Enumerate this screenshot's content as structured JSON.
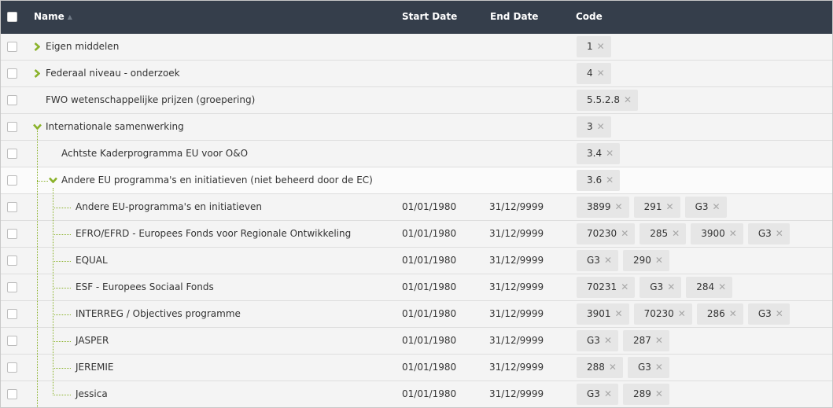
{
  "header": {
    "name": "Name",
    "start_date": "Start Date",
    "end_date": "End Date",
    "code": "Code"
  },
  "rows": [
    {
      "name": "Eigen middelen",
      "start": "",
      "end": "",
      "codes": [
        "1"
      ]
    },
    {
      "name": "Federaal niveau - onderzoek",
      "start": "",
      "end": "",
      "codes": [
        "4"
      ]
    },
    {
      "name": "FWO wetenschappelijke prijzen (groepering)",
      "start": "",
      "end": "",
      "codes": [
        "5.5.2.8"
      ]
    },
    {
      "name": "Internationale samenwerking",
      "start": "",
      "end": "",
      "codes": [
        "3"
      ]
    },
    {
      "name": "Achtste Kaderprogramma EU voor O&O",
      "start": "",
      "end": "",
      "codes": [
        "3.4"
      ]
    },
    {
      "name": "Andere EU programma's en initiatieven (niet beheerd door de EC)",
      "start": "",
      "end": "",
      "codes": [
        "3.6"
      ]
    },
    {
      "name": "Andere EU-programma's en initiatieven",
      "start": "01/01/1980",
      "end": "31/12/9999",
      "codes": [
        "3899",
        "291",
        "G3"
      ]
    },
    {
      "name": "EFRO/EFRD - Europees Fonds voor Regionale Ontwikkeling",
      "start": "01/01/1980",
      "end": "31/12/9999",
      "codes": [
        "70230",
        "285",
        "3900",
        "G3"
      ]
    },
    {
      "name": "EQUAL",
      "start": "01/01/1980",
      "end": "31/12/9999",
      "codes": [
        "G3",
        "290"
      ]
    },
    {
      "name": "ESF - Europees Sociaal Fonds",
      "start": "01/01/1980",
      "end": "31/12/9999",
      "codes": [
        "70231",
        "G3",
        "284"
      ]
    },
    {
      "name": "INTERREG / Objectives programme",
      "start": "01/01/1980",
      "end": "31/12/9999",
      "codes": [
        "3901",
        "70230",
        "286",
        "G3"
      ]
    },
    {
      "name": "JASPER",
      "start": "01/01/1980",
      "end": "31/12/9999",
      "codes": [
        "G3",
        "287"
      ]
    },
    {
      "name": "JEREMIE",
      "start": "01/01/1980",
      "end": "31/12/9999",
      "codes": [
        "288",
        "G3"
      ]
    },
    {
      "name": "Jessica",
      "start": "01/01/1980",
      "end": "31/12/9999",
      "codes": [
        "G3",
        "289"
      ]
    }
  ],
  "icons": {
    "collapsed": "chevron-right-icon",
    "expanded": "chevron-down-icon",
    "remove": "close-icon",
    "sort": "sort-asc-icon"
  },
  "colors": {
    "header_bg": "#353e4b",
    "accent": "#8ab22a",
    "chip_bg": "#e6e6e6"
  }
}
